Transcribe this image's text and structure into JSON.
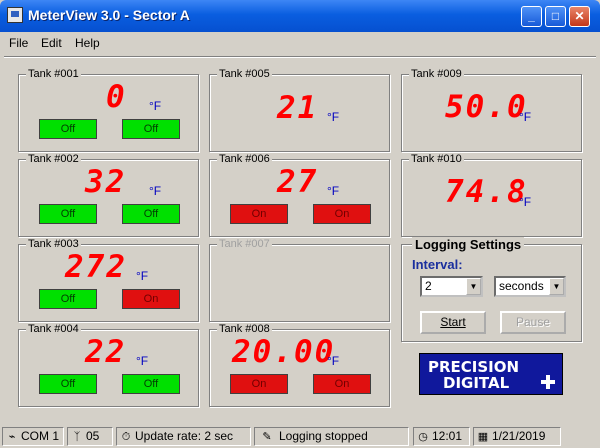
{
  "window": {
    "title": "MeterView 3.0 - Sector A",
    "app_icon": "meter-app-icon",
    "controls": {
      "minimize": "_",
      "maximize": "□",
      "close": "✕"
    }
  },
  "menu": {
    "items": [
      "File",
      "Edit",
      "Help"
    ]
  },
  "tanks": [
    {
      "label": "Tank #001",
      "reading": "0",
      "unit": "°F",
      "relays": [
        "Off",
        "Off"
      ],
      "relay_states": [
        "off",
        "off"
      ]
    },
    {
      "label": "Tank #002",
      "reading": "32",
      "unit": "°F",
      "relays": [
        "Off",
        "Off"
      ],
      "relay_states": [
        "off",
        "off"
      ]
    },
    {
      "label": "Tank #003",
      "reading": "272",
      "unit": "°F",
      "relays": [
        "Off",
        "On"
      ],
      "relay_states": [
        "off",
        "on"
      ]
    },
    {
      "label": "Tank #004",
      "reading": "22",
      "unit": "°F",
      "relays": [
        "Off",
        "Off"
      ],
      "relay_states": [
        "off",
        "off"
      ]
    },
    {
      "label": "Tank #005",
      "reading": "21",
      "unit": "°F"
    },
    {
      "label": "Tank #006",
      "reading": "27",
      "unit": "°F",
      "relays": [
        "On",
        "On"
      ],
      "relay_states": [
        "on",
        "on"
      ]
    },
    {
      "label": "Tank #007",
      "reading": "",
      "unit": "",
      "disabled": true
    },
    {
      "label": "Tank #008",
      "reading": "20.00",
      "unit": "°F",
      "relays": [
        "On",
        "On"
      ],
      "relay_states": [
        "on",
        "on"
      ]
    },
    {
      "label": "Tank #009",
      "reading": "50.0",
      "unit": "°F"
    },
    {
      "label": "Tank #010",
      "reading": "74.8",
      "unit": "°F"
    }
  ],
  "logging": {
    "title": "Logging Settings",
    "interval_label": "Interval:",
    "interval_value": "2",
    "interval_unit": "seconds",
    "start_label": "Start",
    "pause_label": "Pause"
  },
  "logo": {
    "line1": "PRECISION",
    "line2": "DIGITAL"
  },
  "status": {
    "port": "COM 1",
    "port_icon": "plug-icon",
    "address": "05",
    "address_icon": "antenna-icon",
    "update_rate": "Update rate: 2 sec",
    "update_icon": "stopwatch-icon",
    "logging": "Logging stopped",
    "logging_icon": "log-icon",
    "time": "12:01",
    "time_icon": "clock-icon",
    "date": "1/21/2019",
    "date_icon": "calendar-icon"
  },
  "colors": {
    "digits": "#ff0000",
    "relay_off": "#00e000",
    "relay_on": "#e01010",
    "logo_bg": "#10189c",
    "accent_label": "#1a2f9e"
  }
}
